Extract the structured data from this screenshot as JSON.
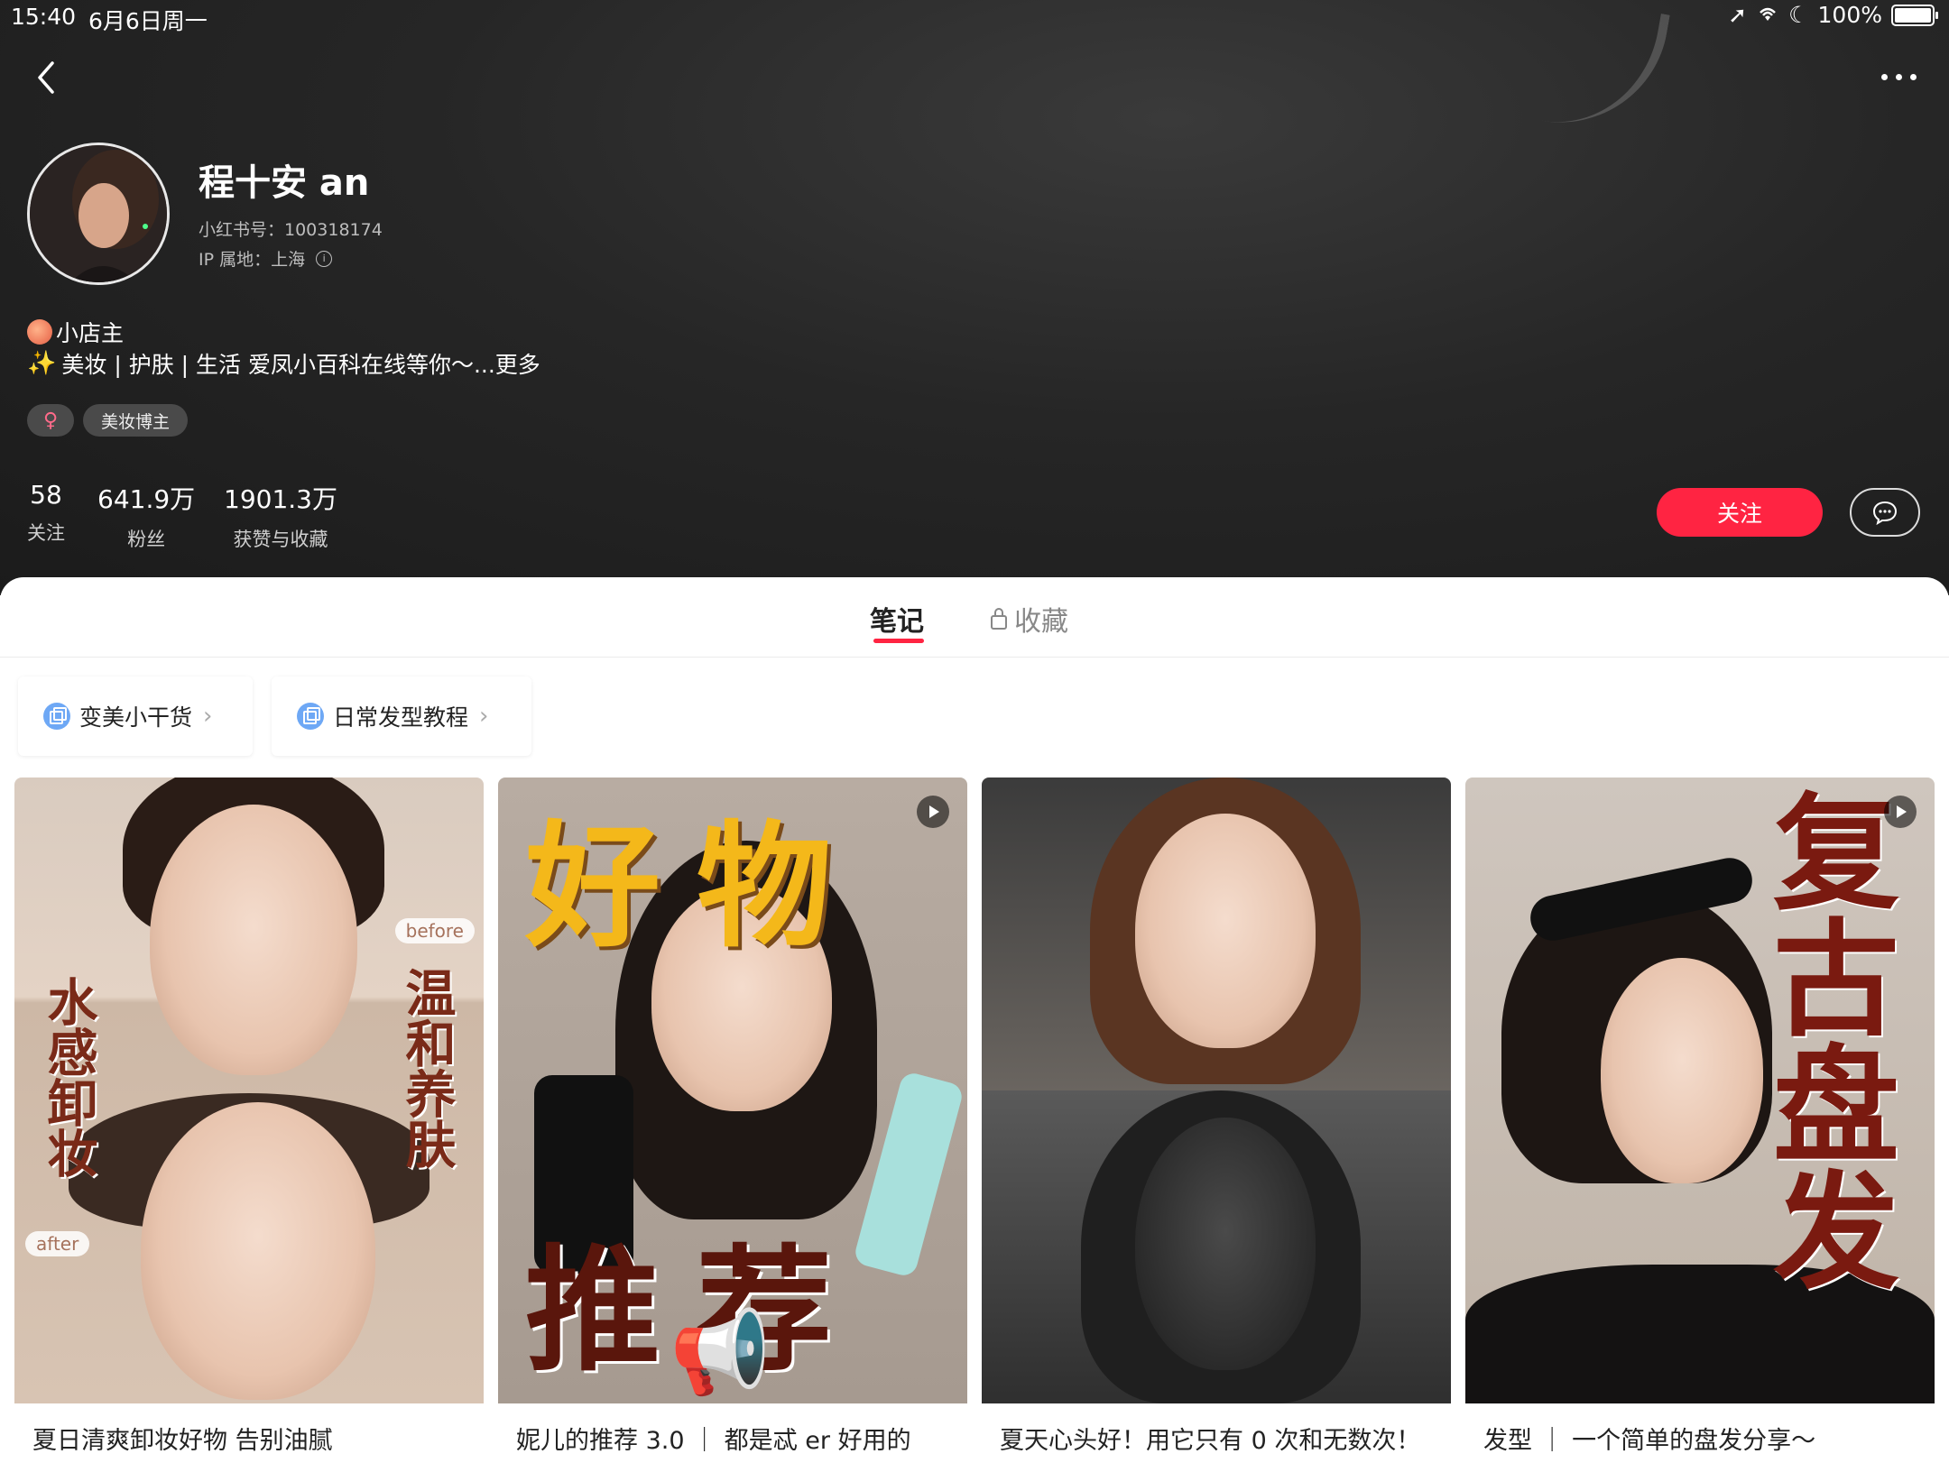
{
  "status_bar": {
    "time": "15:40",
    "date": "6月6日周一",
    "battery": "100%"
  },
  "profile": {
    "nickname": "程十安 an",
    "red_id": "小红书号：100318174",
    "ip_location": "IP 属地：上海",
    "bio_line1": "小店主",
    "bio_line2": "美妆 | 护肤 | 生活 爱凤小百科在线等你～...更多",
    "gender_tag": "♀",
    "category_tag": "美妆博主"
  },
  "stats": [
    {
      "value": "58",
      "label": "关注"
    },
    {
      "value": "641.9万",
      "label": "粉丝"
    },
    {
      "value": "1901.3万",
      "label": "获赞与收藏"
    }
  ],
  "actions": {
    "follow_label": "关注"
  },
  "tabs": {
    "notes": "笔记",
    "collections": "收藏"
  },
  "collections": [
    {
      "label": "变美小干货"
    },
    {
      "label": "日常发型教程"
    }
  ],
  "cards": [
    {
      "title": "夏日清爽卸妆好物 告别油腻",
      "overlay_left": "水感卸妆",
      "overlay_right": "温和养肤",
      "badge_before": "before",
      "badge_after": "after",
      "has_video": false
    },
    {
      "title": "妮儿的推荐 3.0 ｜ 都是忒 er 好用的",
      "overlay_top": "好物",
      "overlay_bottom": "推荐",
      "has_video": true
    },
    {
      "title": "夏天心头好！用它只有 0 次和无数次！",
      "has_video": false
    },
    {
      "title": "发型 ｜ 一个简单的盘发分享～",
      "overlay_right": "复古盘发",
      "has_video": true
    }
  ],
  "colors": {
    "accent": "#ff2442",
    "header_bg": "#262626"
  }
}
